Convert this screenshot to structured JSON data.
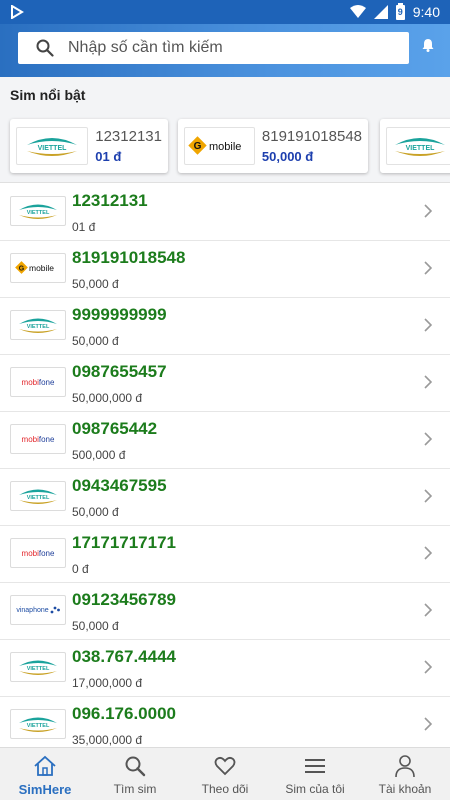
{
  "status_bar": {
    "time": "9:40",
    "battery_glyph": "9"
  },
  "search": {
    "placeholder": "Nhập số cần tìm kiếm"
  },
  "featured": {
    "title": "Sim nổi bật",
    "cards": [
      {
        "carrier": "viettel",
        "number": "12312131",
        "price": "01 đ"
      },
      {
        "carrier": "gmobile",
        "number": "819191018548",
        "price": "50,000 đ"
      },
      {
        "carrier": "viettel",
        "number": "",
        "price": ""
      }
    ]
  },
  "carrier_logo_text": {
    "viettel": "VIETTEL",
    "gmobile": "mobile",
    "mobifone_mobi": "mobi",
    "mobifone_fone": "fone",
    "vinaphone": "vinaphone"
  },
  "listings": [
    {
      "carrier": "viettel",
      "number": "12312131",
      "price": "01 đ"
    },
    {
      "carrier": "gmobile",
      "number": "819191018548",
      "price": "50,000 đ"
    },
    {
      "carrier": "viettel",
      "number": "9999999999",
      "price": "50,000 đ"
    },
    {
      "carrier": "mobifone",
      "number": "0987655457",
      "price": "50,000,000 đ"
    },
    {
      "carrier": "mobifone",
      "number": "098765442",
      "price": "500,000 đ"
    },
    {
      "carrier": "viettel",
      "number": "0943467595",
      "price": "50,000 đ"
    },
    {
      "carrier": "mobifone",
      "number": "17171717171",
      "price": "0 đ"
    },
    {
      "carrier": "vinaphone",
      "number": "09123456789",
      "price": "50,000 đ"
    },
    {
      "carrier": "viettel",
      "number": "038.767.4444",
      "price": "17,000,000 đ"
    },
    {
      "carrier": "viettel",
      "number": "096.176.0000",
      "price": "35,000,000 đ"
    }
  ],
  "bottom_nav": [
    {
      "label": "SimHere",
      "icon": "home-icon",
      "active": true
    },
    {
      "label": "Tìm sim",
      "icon": "search-icon",
      "active": false
    },
    {
      "label": "Theo dõi",
      "icon": "heart-icon",
      "active": false
    },
    {
      "label": "Sim của tôi",
      "icon": "menu-icon",
      "active": false
    },
    {
      "label": "Tài khoản",
      "icon": "person-icon",
      "active": false
    }
  ],
  "colors": {
    "header": "#2a6fc0",
    "number_green": "#1c7c1c",
    "featured_price_blue": "#1d3fae",
    "viettel_teal": "#1ba39c",
    "viettel_gold": "#c9a227",
    "mobifone_blue": "#1f3f9a",
    "mobifone_red": "#e2262b"
  }
}
